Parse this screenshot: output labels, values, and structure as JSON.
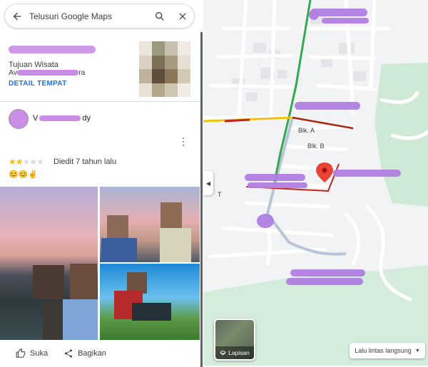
{
  "search": {
    "placeholder": "Telusuri Google Maps"
  },
  "place": {
    "type": "Tujuan Wisata",
    "address_prefix": "Av",
    "address_suffix": "ra",
    "detail_link": "DETAIL TEMPAT"
  },
  "review": {
    "name_prefix": "V",
    "name_suffix": "dy",
    "rating": 2,
    "rating_max": 5,
    "date": "Diedit 7 tahun lalu",
    "emoji": "😊😊✌"
  },
  "actions": {
    "like": "Suka",
    "share": "Bagikan"
  },
  "map": {
    "labels": {
      "blk_a": "Blk. A",
      "blk_b": "Blk. B",
      "t": "T"
    },
    "layers_label": "Lapisan",
    "traffic_label": "Lalu lintas langsung",
    "colors": {
      "accent": "#1a73e8",
      "pin": "#ea4335",
      "green_road": "#34a853",
      "park": "#ceead6",
      "redaction": "#b07ee0"
    }
  },
  "icons": [
    "back-arrow-icon",
    "search-icon",
    "close-icon",
    "more-vert-icon",
    "thumb-up-icon",
    "share-icon",
    "chevron-left-icon",
    "map-pin-icon",
    "layers-icon",
    "dropdown-caret-icon"
  ]
}
